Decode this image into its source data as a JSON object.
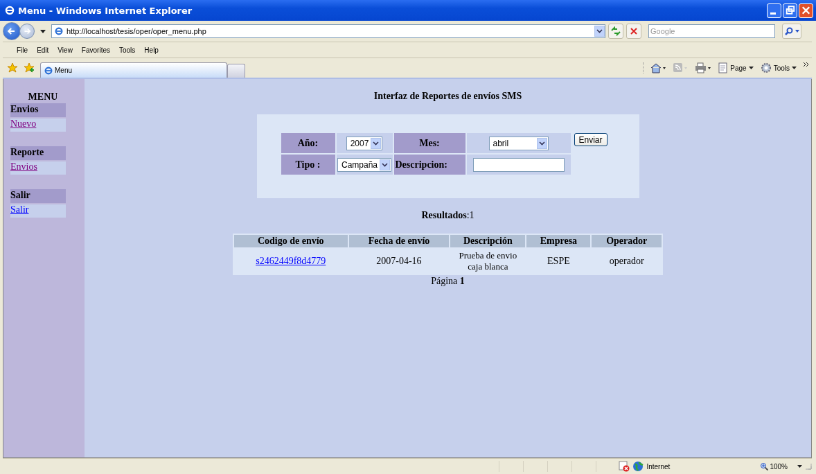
{
  "window": {
    "title": "Menu - Windows Internet Explorer"
  },
  "address_bar": {
    "url": "http://localhost/tesis/oper/oper_menu.php"
  },
  "search": {
    "placeholder": "Google"
  },
  "menu_bar": [
    "File",
    "Edit",
    "View",
    "Favorites",
    "Tools",
    "Help"
  ],
  "tabs": [
    {
      "label": "Menu",
      "selected": true
    }
  ],
  "command_bar": [
    "Page",
    "Tools"
  ],
  "sidebar": {
    "title": "MENU",
    "sections": [
      {
        "heading": "Envios",
        "links": [
          {
            "label": "Nuevo",
            "visited": true
          }
        ]
      },
      {
        "heading": "Reporte",
        "links": [
          {
            "label": "Envios",
            "visited": true
          }
        ]
      },
      {
        "heading": "Salir",
        "links": [
          {
            "label": "Salir",
            "visited": false
          }
        ]
      }
    ]
  },
  "main": {
    "title": "Interfaz de Reportes de envíos SMS",
    "form": {
      "year_label": "Año:",
      "year": "2007",
      "month_label": "Mes:",
      "month": "abril",
      "submit": "Enviar",
      "type_label": "Tipo :",
      "type": "Campaña",
      "description_label": "Descripcion:"
    },
    "results": "**Resultados**:1",
    "table": {
      "columns": [
        "Codigo de envío",
        "Fecha de envío",
        "Descripción",
        "Empresa",
        "Operador"
      ],
      "rows": [
        {
          "code": "s2462449f8d4779",
          "date": "2007-04-16",
          "description": "Prueba de envio caja blanca",
          "company": "ESPE",
          "operator": "operador"
        }
      ]
    },
    "pagination": "Página **1**"
  },
  "status_bar": {
    "zone": "Internet",
    "zoom": "100%"
  }
}
